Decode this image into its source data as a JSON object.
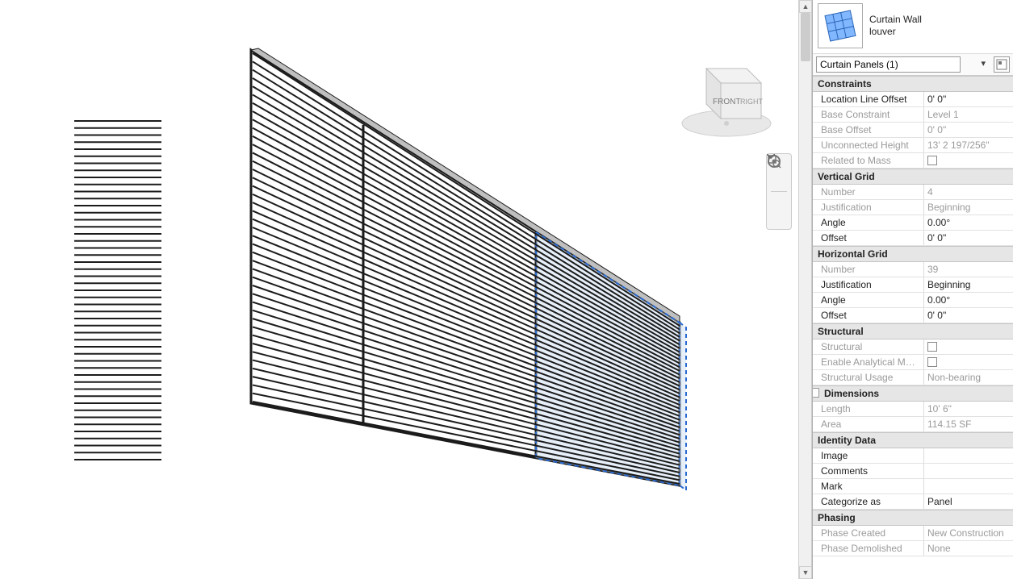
{
  "type_header": {
    "family": "Curtain Wall",
    "type": "louver"
  },
  "type_selector": {
    "value": "Curtain Panels (1)"
  },
  "nav_cube": {
    "face_left": "FRONT",
    "face_right": "RIGHT"
  },
  "groups": [
    {
      "name": "Constraints",
      "rows": [
        {
          "label": "Location Line Offset",
          "value": "0'  0\"",
          "disabled": false
        },
        {
          "label": "Base Constraint",
          "value": "Level 1",
          "disabled": true
        },
        {
          "label": "Base Offset",
          "value": "0'  0\"",
          "disabled": true
        },
        {
          "label": "Unconnected Height",
          "value": "13'  2 197/256\"",
          "disabled": true
        },
        {
          "label": "Related to Mass",
          "value": "",
          "checkbox": true,
          "disabled": true
        }
      ]
    },
    {
      "name": "Vertical Grid",
      "rows": [
        {
          "label": "Number",
          "value": "4",
          "disabled": true
        },
        {
          "label": "Justification",
          "value": "Beginning",
          "disabled": true
        },
        {
          "label": "Angle",
          "value": "0.00°",
          "disabled": false
        },
        {
          "label": "Offset",
          "value": "0'  0\"",
          "disabled": false
        }
      ]
    },
    {
      "name": "Horizontal Grid",
      "rows": [
        {
          "label": "Number",
          "value": "39",
          "disabled": true
        },
        {
          "label": "Justification",
          "value": "Beginning",
          "disabled": false
        },
        {
          "label": "Angle",
          "value": "0.00°",
          "disabled": false
        },
        {
          "label": "Offset",
          "value": "0'  0\"",
          "disabled": false
        }
      ]
    },
    {
      "name": "Structural",
      "rows": [
        {
          "label": "Structural",
          "value": "",
          "checkbox": true,
          "disabled": true
        },
        {
          "label": "Enable Analytical Model",
          "value": "",
          "checkbox": true,
          "disabled": true
        },
        {
          "label": "Structural Usage",
          "value": "Non-bearing",
          "disabled": true
        }
      ]
    },
    {
      "name": "Dimensions",
      "swatch": true,
      "rows": [
        {
          "label": "Length",
          "value": "10'  6\"",
          "disabled": true
        },
        {
          "label": "Area",
          "value": "114.15 SF",
          "disabled": true
        }
      ]
    },
    {
      "name": "Identity Data",
      "rows": [
        {
          "label": "Image",
          "value": "",
          "disabled": false
        },
        {
          "label": "Comments",
          "value": "",
          "disabled": false
        },
        {
          "label": "Mark",
          "value": "",
          "disabled": false
        },
        {
          "label": "Categorize as",
          "value": "Panel",
          "disabled": false
        }
      ]
    },
    {
      "name": "Phasing",
      "rows": [
        {
          "label": "Phase Created",
          "value": "New Construction",
          "disabled": true
        },
        {
          "label": "Phase Demolished",
          "value": "None",
          "disabled": true
        }
      ]
    }
  ],
  "tools": {
    "steering_wheel": "steering-wheel-icon",
    "menu": "chevron-down-icon",
    "zoom_region": "zoom-region-icon",
    "menu2": "chevron-down-icon"
  },
  "colors": {
    "selection_fill": "#c9dcf2",
    "selection_stroke": "#2a6bd1",
    "slat": "#1b1b1b"
  }
}
